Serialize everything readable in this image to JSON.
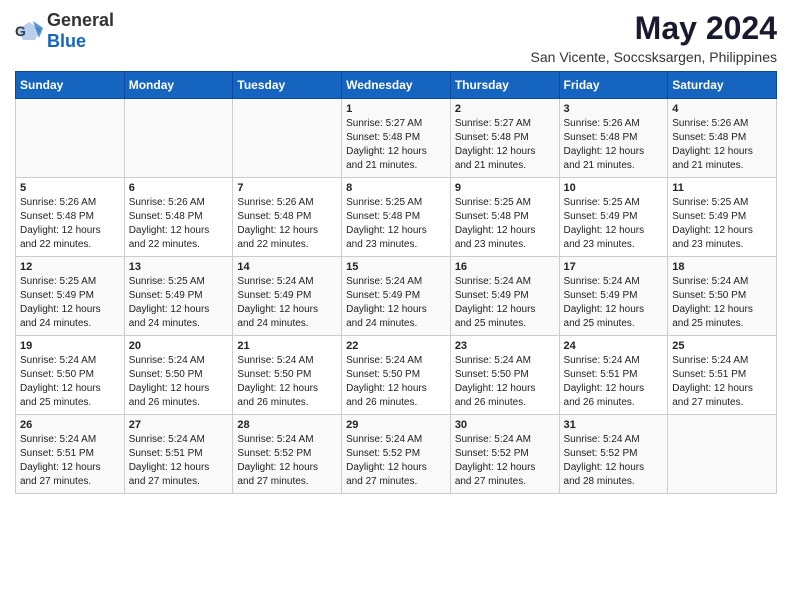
{
  "header": {
    "logo_general": "General",
    "logo_blue": "Blue",
    "title": "May 2024",
    "subtitle": "San Vicente, Soccsksargen, Philippines"
  },
  "days_of_week": [
    "Sunday",
    "Monday",
    "Tuesday",
    "Wednesday",
    "Thursday",
    "Friday",
    "Saturday"
  ],
  "weeks": [
    [
      {
        "day": "",
        "content": ""
      },
      {
        "day": "",
        "content": ""
      },
      {
        "day": "",
        "content": ""
      },
      {
        "day": "1",
        "content": "Sunrise: 5:27 AM\nSunset: 5:48 PM\nDaylight: 12 hours\nand 21 minutes."
      },
      {
        "day": "2",
        "content": "Sunrise: 5:27 AM\nSunset: 5:48 PM\nDaylight: 12 hours\nand 21 minutes."
      },
      {
        "day": "3",
        "content": "Sunrise: 5:26 AM\nSunset: 5:48 PM\nDaylight: 12 hours\nand 21 minutes."
      },
      {
        "day": "4",
        "content": "Sunrise: 5:26 AM\nSunset: 5:48 PM\nDaylight: 12 hours\nand 21 minutes."
      }
    ],
    [
      {
        "day": "5",
        "content": "Sunrise: 5:26 AM\nSunset: 5:48 PM\nDaylight: 12 hours\nand 22 minutes."
      },
      {
        "day": "6",
        "content": "Sunrise: 5:26 AM\nSunset: 5:48 PM\nDaylight: 12 hours\nand 22 minutes."
      },
      {
        "day": "7",
        "content": "Sunrise: 5:26 AM\nSunset: 5:48 PM\nDaylight: 12 hours\nand 22 minutes."
      },
      {
        "day": "8",
        "content": "Sunrise: 5:25 AM\nSunset: 5:48 PM\nDaylight: 12 hours\nand 23 minutes."
      },
      {
        "day": "9",
        "content": "Sunrise: 5:25 AM\nSunset: 5:48 PM\nDaylight: 12 hours\nand 23 minutes."
      },
      {
        "day": "10",
        "content": "Sunrise: 5:25 AM\nSunset: 5:49 PM\nDaylight: 12 hours\nand 23 minutes."
      },
      {
        "day": "11",
        "content": "Sunrise: 5:25 AM\nSunset: 5:49 PM\nDaylight: 12 hours\nand 23 minutes."
      }
    ],
    [
      {
        "day": "12",
        "content": "Sunrise: 5:25 AM\nSunset: 5:49 PM\nDaylight: 12 hours\nand 24 minutes."
      },
      {
        "day": "13",
        "content": "Sunrise: 5:25 AM\nSunset: 5:49 PM\nDaylight: 12 hours\nand 24 minutes."
      },
      {
        "day": "14",
        "content": "Sunrise: 5:24 AM\nSunset: 5:49 PM\nDaylight: 12 hours\nand 24 minutes."
      },
      {
        "day": "15",
        "content": "Sunrise: 5:24 AM\nSunset: 5:49 PM\nDaylight: 12 hours\nand 24 minutes."
      },
      {
        "day": "16",
        "content": "Sunrise: 5:24 AM\nSunset: 5:49 PM\nDaylight: 12 hours\nand 25 minutes."
      },
      {
        "day": "17",
        "content": "Sunrise: 5:24 AM\nSunset: 5:49 PM\nDaylight: 12 hours\nand 25 minutes."
      },
      {
        "day": "18",
        "content": "Sunrise: 5:24 AM\nSunset: 5:50 PM\nDaylight: 12 hours\nand 25 minutes."
      }
    ],
    [
      {
        "day": "19",
        "content": "Sunrise: 5:24 AM\nSunset: 5:50 PM\nDaylight: 12 hours\nand 25 minutes."
      },
      {
        "day": "20",
        "content": "Sunrise: 5:24 AM\nSunset: 5:50 PM\nDaylight: 12 hours\nand 26 minutes."
      },
      {
        "day": "21",
        "content": "Sunrise: 5:24 AM\nSunset: 5:50 PM\nDaylight: 12 hours\nand 26 minutes."
      },
      {
        "day": "22",
        "content": "Sunrise: 5:24 AM\nSunset: 5:50 PM\nDaylight: 12 hours\nand 26 minutes."
      },
      {
        "day": "23",
        "content": "Sunrise: 5:24 AM\nSunset: 5:50 PM\nDaylight: 12 hours\nand 26 minutes."
      },
      {
        "day": "24",
        "content": "Sunrise: 5:24 AM\nSunset: 5:51 PM\nDaylight: 12 hours\nand 26 minutes."
      },
      {
        "day": "25",
        "content": "Sunrise: 5:24 AM\nSunset: 5:51 PM\nDaylight: 12 hours\nand 27 minutes."
      }
    ],
    [
      {
        "day": "26",
        "content": "Sunrise: 5:24 AM\nSunset: 5:51 PM\nDaylight: 12 hours\nand 27 minutes."
      },
      {
        "day": "27",
        "content": "Sunrise: 5:24 AM\nSunset: 5:51 PM\nDaylight: 12 hours\nand 27 minutes."
      },
      {
        "day": "28",
        "content": "Sunrise: 5:24 AM\nSunset: 5:52 PM\nDaylight: 12 hours\nand 27 minutes."
      },
      {
        "day": "29",
        "content": "Sunrise: 5:24 AM\nSunset: 5:52 PM\nDaylight: 12 hours\nand 27 minutes."
      },
      {
        "day": "30",
        "content": "Sunrise: 5:24 AM\nSunset: 5:52 PM\nDaylight: 12 hours\nand 27 minutes."
      },
      {
        "day": "31",
        "content": "Sunrise: 5:24 AM\nSunset: 5:52 PM\nDaylight: 12 hours\nand 28 minutes."
      },
      {
        "day": "",
        "content": ""
      }
    ]
  ]
}
